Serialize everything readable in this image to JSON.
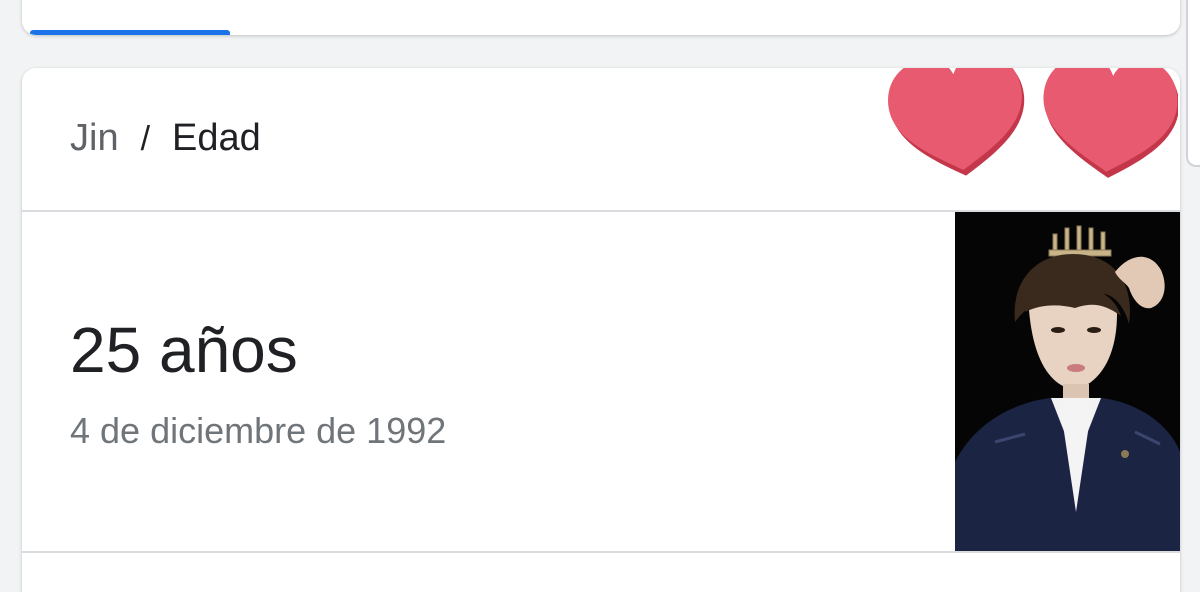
{
  "breadcrumb": {
    "entity": "Jin",
    "separator": "/",
    "attribute": "Edad"
  },
  "answer": {
    "value": "25 años",
    "detail": "4 de diciembre de 1992"
  },
  "decorations": {
    "heart_color": "#e85a6f",
    "icons": [
      "heart-icon",
      "heart-icon"
    ]
  },
  "colors": {
    "accent": "#1a73e8",
    "primary_text": "#202124",
    "secondary_text": "#70757a",
    "divider": "#dadce0"
  }
}
